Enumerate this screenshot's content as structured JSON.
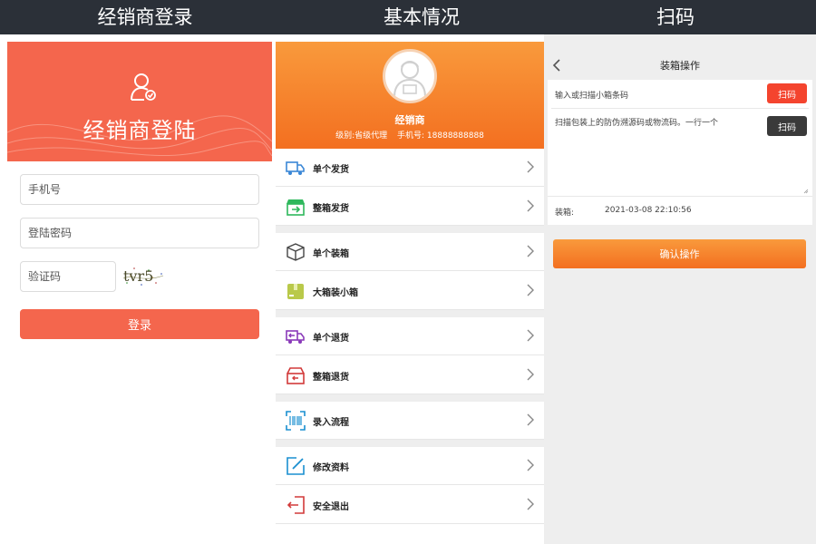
{
  "sections": {
    "login": "经销商登录",
    "profile": "基本情况",
    "scan": "扫码"
  },
  "login": {
    "title": "经销商登陆",
    "phone_placeholder": "手机号",
    "password_placeholder": "登陆密码",
    "captcha_placeholder": "验证码",
    "captcha_text": "tvr5",
    "submit_label": "登录",
    "accent": "#f4664d"
  },
  "profile": {
    "name": "经销商",
    "level": "级别:省级代理",
    "phone": "手机号: 18888888888",
    "menu": [
      {
        "label": "单个发货",
        "icon": "truck-icon"
      },
      {
        "label": "整箱发货",
        "icon": "box-arrow-icon"
      },
      {
        "label": "单个装箱",
        "icon": "cube-icon"
      },
      {
        "label": "大箱装小箱",
        "icon": "package-icon"
      },
      {
        "label": "单个退货",
        "icon": "return-truck-icon"
      },
      {
        "label": "整箱退货",
        "icon": "return-box-icon"
      },
      {
        "label": "录入流程",
        "icon": "barcode-scan-icon"
      },
      {
        "label": "修改资料",
        "icon": "edit-icon"
      },
      {
        "label": "安全退出",
        "icon": "logout-icon"
      }
    ]
  },
  "scan": {
    "title": "装箱操作",
    "small_box_prompt": "输入或扫描小箱条码",
    "big_box_prompt": "扫描包装上的防伪溯源码或物流码。一行一个",
    "scan_label": "扫码",
    "packing_label": "装箱:",
    "packing_time": "2021-03-08 22:10:56",
    "confirm_label": "确认操作"
  }
}
